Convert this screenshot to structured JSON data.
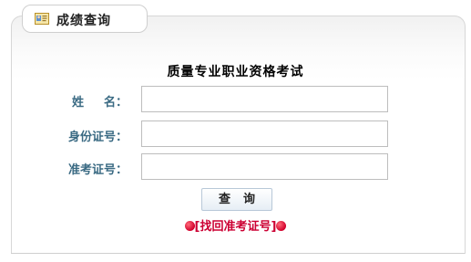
{
  "tab": {
    "title": "成绩查询",
    "icon": "id-card-icon"
  },
  "form": {
    "title": "质量专业职业资格考试",
    "fields": [
      {
        "label_a": "姓",
        "label_b": "名：",
        "value": "",
        "placeholder": ""
      },
      {
        "label": "身份证号：",
        "value": "",
        "placeholder": ""
      },
      {
        "label": "准考证号：",
        "value": "",
        "placeholder": ""
      }
    ],
    "query_char_1": "查",
    "query_char_2": "询",
    "retrieve_text": "[找回准考证号]"
  },
  "colors": {
    "label": "#3a6a83",
    "link": "#cc0033",
    "border": "#d7d7d7"
  }
}
